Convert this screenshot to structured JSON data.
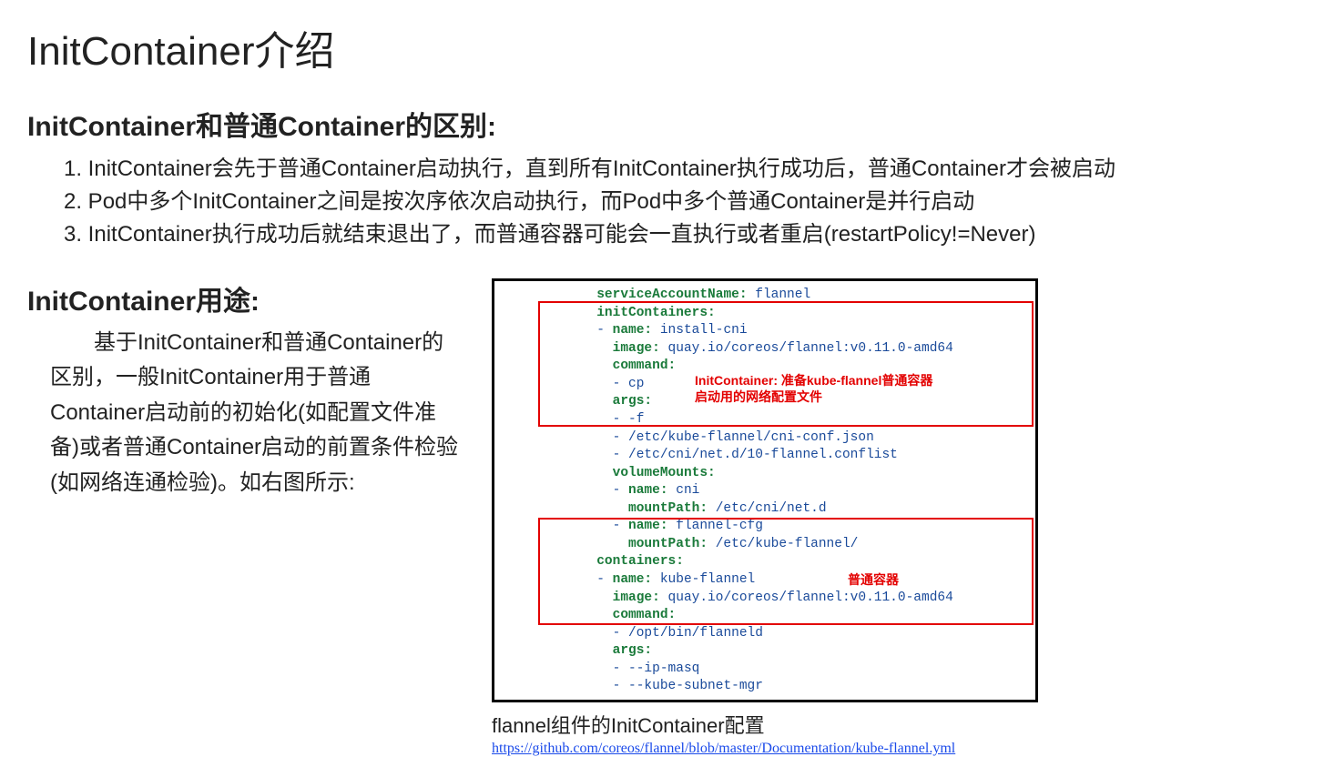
{
  "title": "InitContainer介绍",
  "section1": {
    "heading": "InitContainer和普通Container的区别:",
    "items": [
      "1. InitContainer会先于普通Container启动执行，直到所有InitContainer执行成功后，普通Container才会被启动",
      "2. Pod中多个InitContainer之间是按次序依次启动执行，而Pod中多个普通Container是并行启动",
      "3. InitContainer执行成功后就结束退出了，而普通容器可能会一直执行或者重启(restartPolicy!=Never)"
    ]
  },
  "section2": {
    "heading": "InitContainer用途:",
    "body": "基于InitContainer和普通Container的区别，一般InitContainer用于普通Container启动前的初始化(如配置文件准备)或者普通Container启动的前置条件检验(如网络连通检验)。如右图所示:"
  },
  "code": {
    "lines": [
      {
        "indent": 3,
        "key": "serviceAccountName:",
        "val": " flannel"
      },
      {
        "indent": 3,
        "key": "initContainers:",
        "val": ""
      },
      {
        "indent": 3,
        "dash": "- ",
        "key": "name:",
        "val": " install-cni"
      },
      {
        "indent": 4,
        "key": "image:",
        "val": " quay.io/coreos/flannel:v0.11.0-amd64"
      },
      {
        "indent": 4,
        "key": "command:",
        "val": ""
      },
      {
        "indent": 4,
        "dash": "- ",
        "val": "cp"
      },
      {
        "indent": 4,
        "key": "args:",
        "val": ""
      },
      {
        "indent": 4,
        "dash": "- ",
        "val": "-f"
      },
      {
        "indent": 4,
        "dash": "- ",
        "val": "/etc/kube-flannel/cni-conf.json"
      },
      {
        "indent": 4,
        "dash": "- ",
        "val": "/etc/cni/net.d/10-flannel.conflist"
      },
      {
        "indent": 4,
        "key": "volumeMounts:",
        "val": ""
      },
      {
        "indent": 4,
        "dash": "- ",
        "key": "name:",
        "val": " cni"
      },
      {
        "indent": 5,
        "key": "mountPath:",
        "val": " /etc/cni/net.d"
      },
      {
        "indent": 4,
        "dash": "- ",
        "key": "name:",
        "val": " flannel-cfg"
      },
      {
        "indent": 5,
        "key": "mountPath:",
        "val": " /etc/kube-flannel/"
      },
      {
        "indent": 3,
        "key": "containers:",
        "val": ""
      },
      {
        "indent": 3,
        "dash": "- ",
        "key": "name:",
        "val": " kube-flannel"
      },
      {
        "indent": 4,
        "key": "image:",
        "val": " quay.io/coreos/flannel:v0.11.0-amd64"
      },
      {
        "indent": 4,
        "key": "command:",
        "val": ""
      },
      {
        "indent": 4,
        "dash": "- ",
        "val": "/opt/bin/flanneld"
      },
      {
        "indent": 4,
        "key": "args:",
        "val": ""
      },
      {
        "indent": 4,
        "dash": "- ",
        "val": "--ip-masq"
      },
      {
        "indent": 4,
        "dash": "- ",
        "val": "--kube-subnet-mgr"
      }
    ],
    "annotation1_l1": "InitContainer: 准备kube-flannel普通容器",
    "annotation1_l2": "启动用的网络配置文件",
    "annotation2": "普通容器"
  },
  "caption": "flannel组件的InitContainer配置",
  "link": "https://github.com/coreos/flannel/blob/master/Documentation/kube-flannel.yml"
}
